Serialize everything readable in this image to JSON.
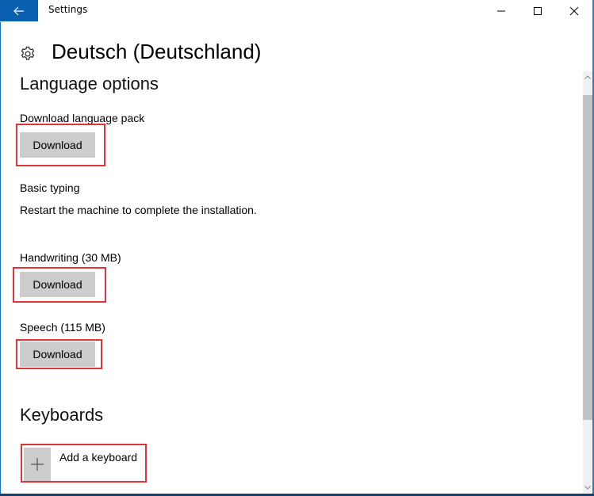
{
  "window": {
    "title": "Settings",
    "accent_color": "#0a60b0",
    "controls": {
      "minimize": "minimize-icon",
      "maximize": "maximize-icon",
      "close": "close-icon"
    }
  },
  "header": {
    "icon": "gear-icon",
    "title": "Deutsch (Deutschland)"
  },
  "language_options": {
    "heading": "Language options",
    "items": [
      {
        "label": "Download language pack",
        "button": "Download",
        "highlighted": true
      },
      {
        "label": "Basic typing",
        "status": "Restart the machine to complete the installation."
      },
      {
        "label": "Handwriting (30 MB)",
        "button": "Download",
        "highlighted": true
      },
      {
        "label": "Speech (115 MB)",
        "button": "Download",
        "highlighted": true
      }
    ]
  },
  "keyboards": {
    "heading": "Keyboards",
    "add_label": "Add a keyboard",
    "add_icon": "plus-icon",
    "highlighted": true
  },
  "highlight_color": "#e0343b"
}
